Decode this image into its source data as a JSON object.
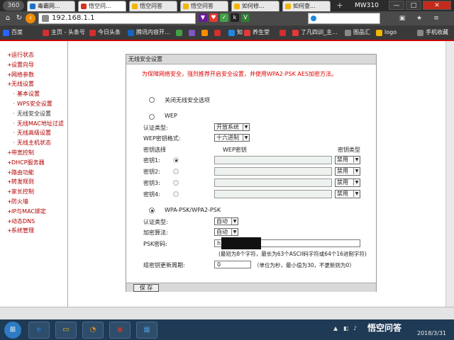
{
  "browser": {
    "logo": "360",
    "tabs": [
      {
        "label": "毒霸网...",
        "color": "#1e70c8"
      },
      {
        "label": "悟空问...",
        "color": "#d6331f"
      },
      {
        "label": "悟空问答",
        "color": "#f2b500"
      },
      {
        "label": "悟空问答",
        "color": "#f2b500"
      },
      {
        "label": "如何修...",
        "color": "#f2b500"
      },
      {
        "label": "如何查...",
        "color": "#f2b500"
      }
    ],
    "new_tab": "+",
    "window_title": "MW310",
    "url": "192.168.1.1",
    "nav": {
      "back": "‹",
      "refresh": "↻",
      "home": "⌂"
    },
    "window_buttons": {
      "minimize": "—",
      "restore": "□",
      "close": "✕"
    },
    "extensions": [
      {
        "label": "▼",
        "color": "#6a1b9a"
      },
      {
        "label": "♥",
        "color": "#e53935"
      },
      {
        "label": "✓",
        "color": "#43a047"
      },
      {
        "label": "k",
        "color": "#222222"
      },
      {
        "label": "V",
        "color": "#2e7d32"
      }
    ],
    "search_icon": "search-icon",
    "toolbar": [
      "▣",
      "★",
      "≡"
    ],
    "bookmarks": [
      {
        "label": "百度",
        "color": "#2962ff"
      },
      {
        "label": "主页 - 头条号",
        "color": "#d32f2f"
      },
      {
        "label": "今日头条",
        "color": "#d32f2f"
      },
      {
        "label": "腾讯内容开...",
        "color": "#1565c0"
      },
      {
        "label": "",
        "color": "#43a047"
      },
      {
        "label": "",
        "color": "#7e57c2"
      },
      {
        "label": "",
        "color": "#fb8c00"
      },
      {
        "label": "",
        "color": "#d32f2f"
      },
      {
        "label": "知",
        "color": "#1e88e5"
      },
      {
        "label": "养生堂",
        "color": "#e53935"
      },
      {
        "label": "",
        "color": "#d32f2f"
      },
      {
        "label": "了凡四训_主...",
        "color": "#e53935"
      },
      {
        "label": "图品汇",
        "color": "#888888"
      },
      {
        "label": "logo",
        "color": "#f2b500"
      },
      {
        "label": "手机收藏",
        "color": "#888888"
      }
    ]
  },
  "menu": [
    {
      "label": "运行状态",
      "level": 0
    },
    {
      "label": "设置向导",
      "level": 0
    },
    {
      "label": "网络参数",
      "level": 0
    },
    {
      "label": "无线设置",
      "level": 0
    },
    {
      "label": "基本设置",
      "level": 1
    },
    {
      "label": "WPS安全设置",
      "level": 1
    },
    {
      "label": "无线安全设置",
      "level": 1,
      "current": true
    },
    {
      "label": "无线MAC地址过滤",
      "level": 1
    },
    {
      "label": "无线高级设置",
      "level": 1
    },
    {
      "label": "无线主机状态",
      "level": 1
    },
    {
      "label": "带宽控制",
      "level": 0
    },
    {
      "label": "DHCP服务器",
      "level": 0
    },
    {
      "label": "路由功能",
      "level": 0
    },
    {
      "label": "转发规则",
      "level": 0
    },
    {
      "label": "家长控制",
      "level": 0
    },
    {
      "label": "防火墙",
      "level": 0
    },
    {
      "label": "IP与MAC绑定",
      "level": 0
    },
    {
      "label": "动态DNS",
      "level": 0
    },
    {
      "label": "系统管理",
      "level": 0
    }
  ],
  "form": {
    "title": "无线安全设置",
    "warning": "为保障网络安全，强烈推荐开启安全设置，并使用WPA2-PSK AES加密方法。",
    "disable_option": "关闭无线安全选项",
    "wep": {
      "label": "WEP",
      "auth_label": "认证类型:",
      "auth_value": "开放系统",
      "format_label": "WEP密钥格式:",
      "format_value": "十六进制",
      "key_select_header": "密钥选择",
      "key_header": "WEP密钥",
      "key_type_header": "密钥类型",
      "keys": [
        {
          "label": "密钥1:",
          "value": "",
          "type": "禁用"
        },
        {
          "label": "密钥2:",
          "value": "",
          "type": "禁用"
        },
        {
          "label": "密钥3:",
          "value": "",
          "type": "禁用"
        },
        {
          "label": "密钥4:",
          "value": "",
          "type": "禁用"
        }
      ]
    },
    "wpa": {
      "label": "WPA-PSK/WPA2-PSK",
      "auth_label": "认证类型:",
      "auth_value": "自动",
      "cipher_label": "加密算法:",
      "cipher_value": "自动",
      "psk_label": "PSK密码:",
      "psk_value": "h",
      "psk_hint": "(最短为8个字符，最长为63个ASCII码字符或64个16进制字符)",
      "group_label": "组密钥更新周期:",
      "group_value": "0",
      "group_hint": "（单位为秒，最小值为30，不更新则为0）"
    },
    "save": "保 存",
    "selected": "wpa"
  },
  "taskbar": {
    "start": "⊞",
    "apps": [
      {
        "label": "e",
        "color": "#1e88e5"
      },
      {
        "label": "▭",
        "color": "#f2b500"
      },
      {
        "label": "◔",
        "color": "#f08c00"
      },
      {
        "label": "◉",
        "color": "#c0392b"
      },
      {
        "label": "▦",
        "color": "#4a90c8"
      }
    ],
    "tray": [
      "▲",
      "◧",
      "♪"
    ],
    "date": "2018/3/31",
    "watermark": "悟空问答"
  }
}
